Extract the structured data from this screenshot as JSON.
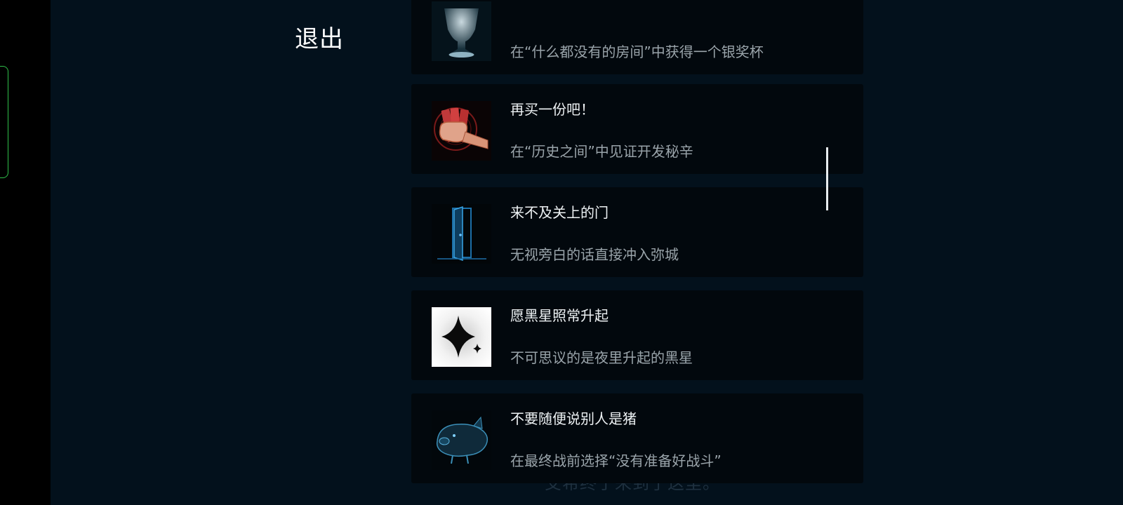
{
  "exit_label": "退出",
  "achievements": [
    {
      "title": "",
      "desc": "在“什么都没有的房间”中获得一个银奖杯",
      "icon": "silver-trophy-icon"
    },
    {
      "title": "再买一份吧！",
      "desc": "在“历史之间”中见证开发秘辛",
      "icon": "fist-with-cash-icon"
    },
    {
      "title": "来不及关上的门",
      "desc": "无视旁白的话直接冲入弥城",
      "icon": "open-door-icon"
    },
    {
      "title": "愿黑星照常升起",
      "desc": "不可思议的是夜里升起的黑星",
      "icon": "black-star-icon"
    },
    {
      "title": "不要随便说别人是猪",
      "desc": "在最终战前选择“没有准备好战斗”",
      "icon": "pig-icon"
    }
  ],
  "subtitle_text": "艾希终于来到了这里。",
  "colors": {
    "background": "#03111c",
    "card": "#02080d",
    "title_text": "#eef2f4",
    "desc_text": "#9aa4aa",
    "side_tab_border": "#2fbf4a"
  }
}
